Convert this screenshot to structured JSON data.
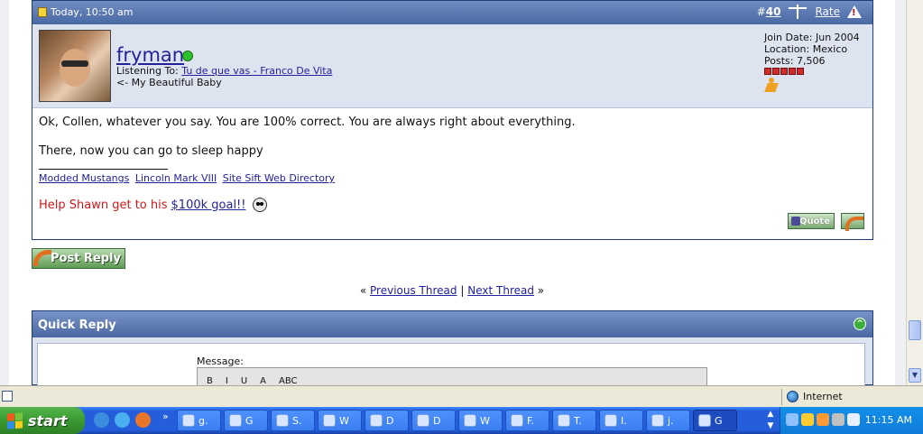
{
  "post": {
    "date": "Today, 10:50 am",
    "number_prefix": "#",
    "number": "40",
    "rate_label": "Rate",
    "username": "fryman",
    "listening_label": "Listening To:",
    "listening_song": "Tu de que vas - Franco De Vita",
    "user_title": "<- My Beautiful Baby",
    "join_date": "Join Date: Jun 2004",
    "location": "Location: Mexico",
    "posts": "Posts: 7,506",
    "message_lines": [
      "Ok, Collen, whatever you say. You are 100% correct. You are always right about everything.",
      "There, now you can go to sleep happy"
    ],
    "signature_links": [
      "Modded Mustangs",
      "Lincoln Mark VIII",
      "Site Sift Web Directory"
    ],
    "help_text": "Help Shawn get to his",
    "help_link": "$100k goal!!",
    "quote_label": "Quote"
  },
  "post_reply_label": "Post Reply",
  "thread_nav": {
    "prev": "Previous Thread",
    "next": "Next Thread",
    "left_marks": "«",
    "right_marks": "»",
    "divider": "|"
  },
  "quick_reply": {
    "title": "Quick Reply",
    "message_label": "Message:",
    "toolbar": [
      "B",
      "I",
      "U",
      "A",
      "ABC"
    ]
  },
  "statusbar": {
    "zone": "Internet"
  },
  "taskbar": {
    "start_label": "start",
    "more_label": "»",
    "tasks": [
      "g.",
      "G",
      "S.",
      "W",
      "D",
      "D",
      "W",
      "F.",
      "T.",
      "I.",
      "j.",
      "G"
    ],
    "clock": "11:15 AM"
  },
  "colors": {
    "header_blue": "#4a68a2",
    "link_blue": "#22229c",
    "help_red": "#cc1a1a",
    "online_green": "#2dc02d",
    "reputation_red": "#cf2b2b"
  }
}
